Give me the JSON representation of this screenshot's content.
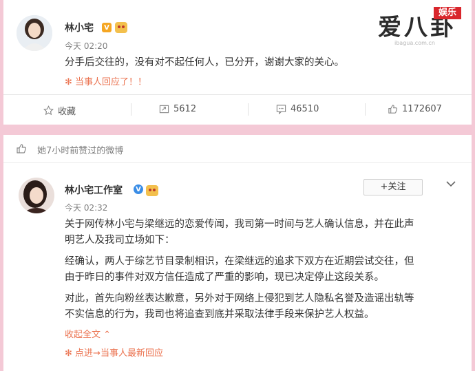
{
  "watermark": {
    "brand": "爱八卦",
    "badge": "娱乐",
    "url": "ibagua.com.cn"
  },
  "post1": {
    "author": "林小宅",
    "time": "今天 02:20",
    "content": "分手后交往的，没有对不起任何人，已分开，谢谢大家的关心。",
    "topic_icon": "✻",
    "topic": "当事人回应了！！",
    "actions": {
      "favorite": "收藏",
      "repost": "5612",
      "comment": "46510",
      "like": "1172607"
    }
  },
  "liked_bar": {
    "text": "她7小时前赞过的微博"
  },
  "post2": {
    "author": "林小宅工作室",
    "time": "今天 02:32",
    "follow_label": "+关注",
    "lines": [
      "关于网传林小宅与梁继远的恋爱传闻，我司第一时间与艺人确认信息，并在此声",
      "明艺人及我司立场如下：",
      "经确认，两人于综艺节目录制相识，在梁继远的追求下双方在近期尝试交往，但",
      "由于昨日的事件对双方信任造成了严重的影响，现已决定停止这段关系。",
      "对此，首先向粉丝表达歉意，另外对于网络上侵犯到艺人隐私名誉及造谣出轨等",
      "不实信息的行为，我司也将追查到底并采取法律手段来保护艺人权益。"
    ],
    "collapse": "收起全文",
    "collapse_arrow": "⌃",
    "topic_icon": "✻",
    "topic": "点进→当事人最新回应"
  }
}
